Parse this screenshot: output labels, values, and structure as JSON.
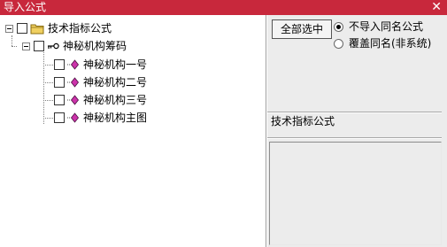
{
  "window": {
    "title": "导入公式",
    "close_glyph": "✕"
  },
  "tree": {
    "root": {
      "label": "技术指标公式",
      "icon": "folder-icon",
      "checked": false
    },
    "group": {
      "label": "神秘机构筹码",
      "icon": "key-icon",
      "checked": false
    },
    "items": [
      {
        "label": "神秘机构一号",
        "icon": "formula-icon",
        "checked": false
      },
      {
        "label": "神秘机构二号",
        "icon": "formula-icon",
        "checked": false
      },
      {
        "label": "神秘机构三号",
        "icon": "formula-icon",
        "checked": false
      },
      {
        "label": "神秘机构主图",
        "icon": "formula-icon",
        "checked": false
      }
    ]
  },
  "options": {
    "select_all_label": "全部选中",
    "radio_skip_label": "不导入同名公式",
    "radio_overwrite_label": "覆盖同名(非系统)",
    "selected": "skip"
  },
  "info": {
    "category": "技术指标公式",
    "description": ""
  },
  "colors": {
    "titlebar": "#c8283c",
    "folder": "#f0d060",
    "formula_icon": "#cc33aa"
  }
}
